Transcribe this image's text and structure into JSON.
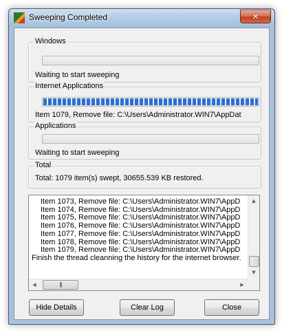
{
  "window": {
    "title": "Sweeping Completed",
    "close_glyph": "✕"
  },
  "groups": {
    "windows": {
      "label": "Windows",
      "status": "Waiting to start sweeping",
      "progress": 0
    },
    "internet": {
      "label": "Internet Applications",
      "status": "Item 1079, Remove file: C:\\Users\\Administrator.WIN7\\AppDat",
      "progress": 1.0
    },
    "applications": {
      "label": "Applications",
      "status": "Waiting to start sweeping",
      "progress": 0
    },
    "total": {
      "label": "Total",
      "summary": "Total: 1079 item(s) swept, 30655.539 KB restored."
    }
  },
  "log": {
    "lines": [
      "Item 1073, Remove file: C:\\Users\\Administrator.WIN7\\AppD",
      "Item 1074, Remove file: C:\\Users\\Administrator.WIN7\\AppD",
      "Item 1075, Remove file: C:\\Users\\Administrator.WIN7\\AppD",
      "Item 1076, Remove file: C:\\Users\\Administrator.WIN7\\AppD",
      "Item 1077, Remove file: C:\\Users\\Administrator.WIN7\\AppD",
      "Item 1078, Remove file: C:\\Users\\Administrator.WIN7\\AppD",
      "Item 1079, Remove file: C:\\Users\\Administrator.WIN7\\AppD"
    ],
    "final_line": "Finish the thread cleanning the history for the internet browser.",
    "hscroll_grip": "|||",
    "arrows": {
      "up": "▲",
      "down": "▼",
      "left": "◀",
      "right": "▶"
    }
  },
  "buttons": {
    "hide_details": "Hide Details",
    "clear_log": "Clear Log",
    "close": "Close"
  },
  "colors": {
    "progress_fill": "#2d6fd6",
    "close_button": "#c0411f"
  },
  "icons": {
    "app": "color-squares-app-icon",
    "close": "close-icon"
  }
}
